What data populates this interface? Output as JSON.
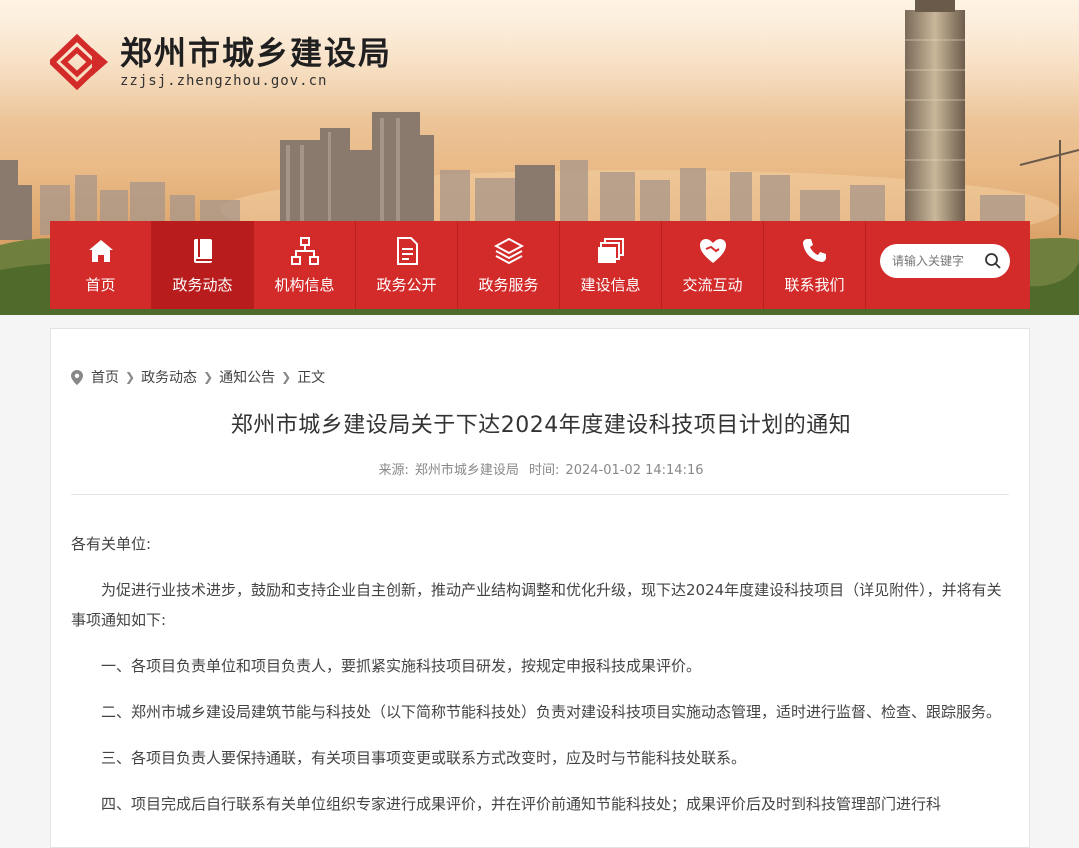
{
  "site": {
    "title": "郑州市城乡建设局",
    "url": "zzjsj.zhengzhou.gov.cn",
    "brand_color": "#d32a2a"
  },
  "nav": {
    "items": [
      {
        "label": "首页",
        "icon": "home-icon"
      },
      {
        "label": "政务动态",
        "icon": "book-icon"
      },
      {
        "label": "机构信息",
        "icon": "org-chart-icon"
      },
      {
        "label": "政务公开",
        "icon": "document-icon"
      },
      {
        "label": "政务服务",
        "icon": "layers-icon"
      },
      {
        "label": "建设信息",
        "icon": "stack-icon"
      },
      {
        "label": "交流互动",
        "icon": "handshake-icon"
      },
      {
        "label": "联系我们",
        "icon": "phone-icon"
      }
    ],
    "active_index": 1
  },
  "search": {
    "placeholder": "请输入关键字"
  },
  "breadcrumb": [
    "首页",
    "政务动态",
    "通知公告",
    "正文"
  ],
  "article": {
    "title": "郑州市城乡建设局关于下达2024年度建设科技项目计划的通知",
    "source_label": "来源:",
    "source": "郑州市城乡建设局",
    "time_label": "时间:",
    "time": "2024-01-02 14:14:16",
    "salutation": "各有关单位:",
    "paragraphs": [
      "为促进行业技术进步，鼓励和支持企业自主创新，推动产业结构调整和优化升级，现下达2024年度建设科技项目（详见附件），并将有关事项通知如下:",
      "一、各项目负责单位和项目负责人，要抓紧实施科技项目研发，按规定申报科技成果评价。",
      "二、郑州市城乡建设局建筑节能与科技处（以下简称节能科技处）负责对建设科技项目实施动态管理，适时进行监督、检查、跟踪服务。",
      "三、各项目负责人要保持通联，有关项目事项变更或联系方式改变时，应及时与节能科技处联系。",
      "四、项目完成后自行联系有关单位组织专家进行成果评价，并在评价前通知节能科技处；成果评价后及时到科技管理部门进行科"
    ]
  }
}
